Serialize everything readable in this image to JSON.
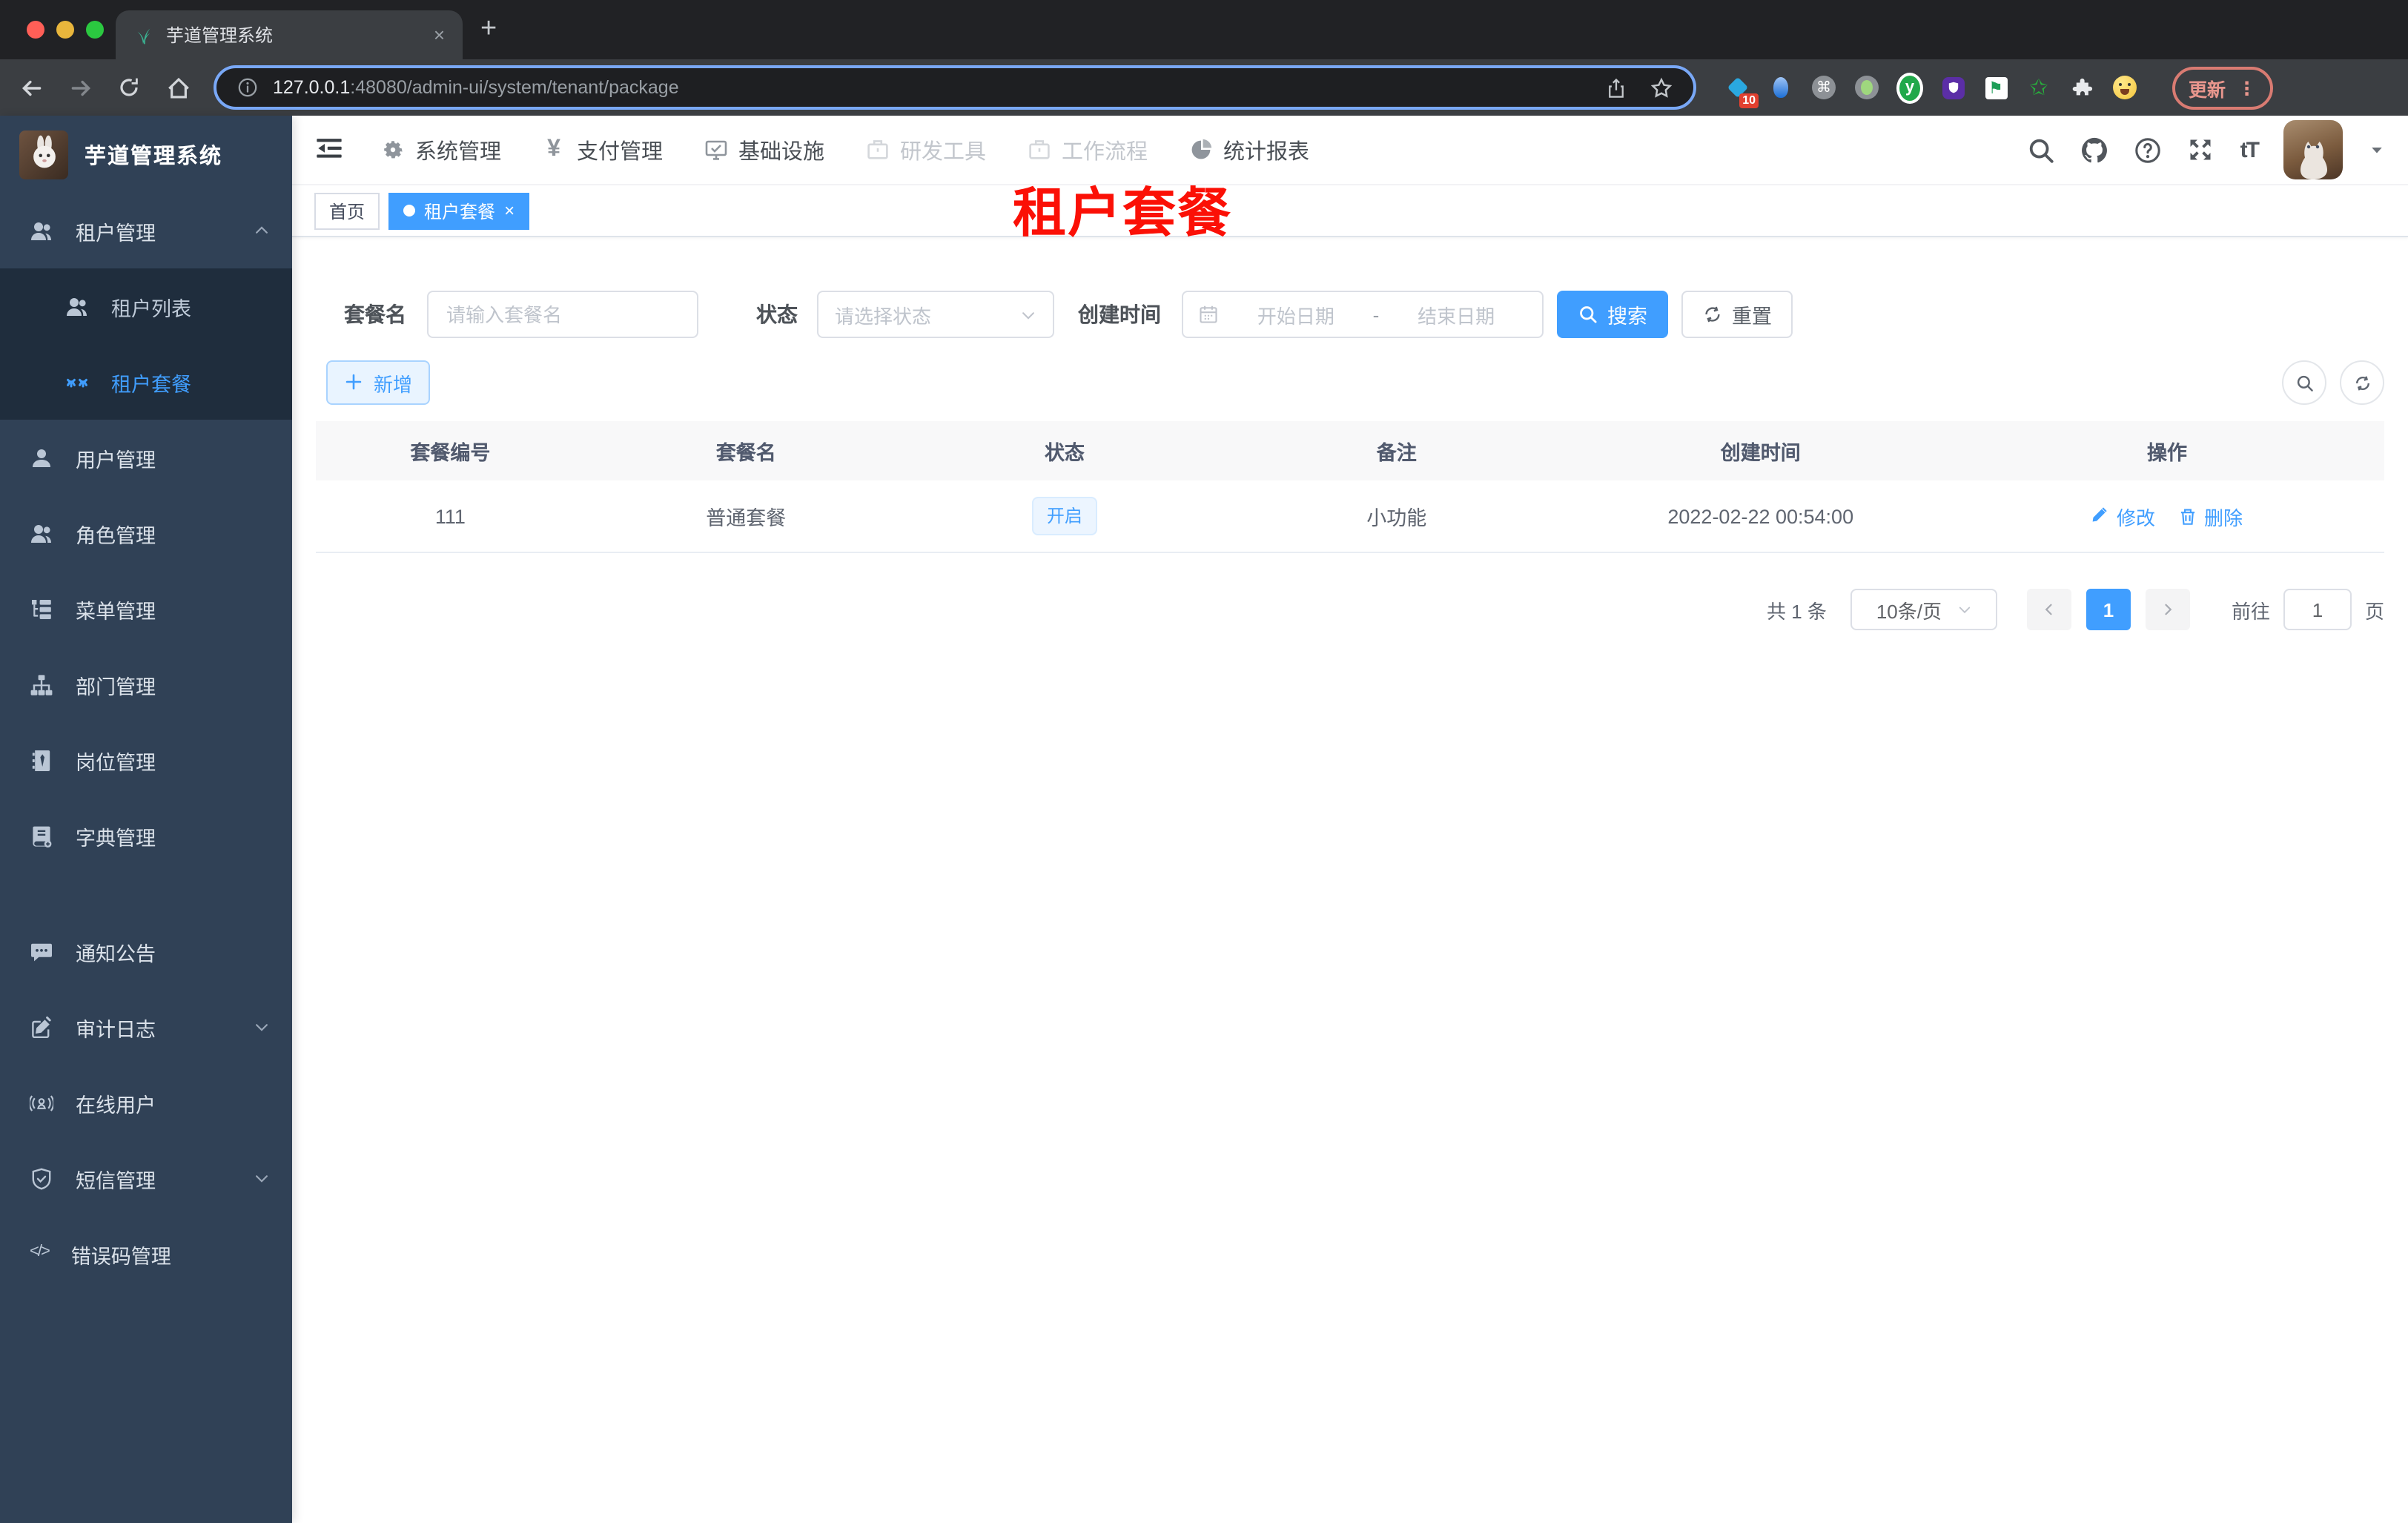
{
  "browser": {
    "tab_title": "芋道管理系统",
    "url_host": "127.0.0.1",
    "url_rest": ":48080/admin-ui/system/tenant/package",
    "update_label": "更新",
    "ext_badge": "10"
  },
  "glyphs": {
    "close": "×",
    "newtab": "+",
    "dots": "⋮",
    "yen": "¥",
    "code": "</>",
    "cmd": "⌘",
    "font_size": "tT",
    "ext_y": "y",
    "flag": "⚑",
    "star": "✩"
  },
  "sidebar": {
    "title": "芋道管理系统",
    "items": [
      {
        "label": "租户管理"
      },
      {
        "label": "租户列表"
      },
      {
        "label": "租户套餐"
      },
      {
        "label": "用户管理"
      },
      {
        "label": "角色管理"
      },
      {
        "label": "菜单管理"
      },
      {
        "label": "部门管理"
      },
      {
        "label": "岗位管理"
      },
      {
        "label": "字典管理"
      },
      {
        "label": "通知公告"
      },
      {
        "label": "审计日志"
      },
      {
        "label": "在线用户"
      },
      {
        "label": "短信管理"
      },
      {
        "label": "错误码管理"
      }
    ]
  },
  "topnav": {
    "items": [
      {
        "label": "系统管理"
      },
      {
        "label": "支付管理"
      },
      {
        "label": "基础设施"
      },
      {
        "label": "研发工具"
      },
      {
        "label": "工作流程"
      },
      {
        "label": "统计报表"
      }
    ]
  },
  "tags": {
    "home": "首页",
    "active": "租户套餐"
  },
  "annotation": "租户套餐",
  "filter": {
    "name_label": "套餐名",
    "name_placeholder": "请输入套餐名",
    "status_label": "状态",
    "status_placeholder": "请选择状态",
    "date_label": "创建时间",
    "date_start": "开始日期",
    "date_sep": "-",
    "date_end": "结束日期",
    "search": "搜索",
    "reset": "重置"
  },
  "toolbar": {
    "add": "新增"
  },
  "table": {
    "columns": [
      "套餐编号",
      "套餐名",
      "状态",
      "备注",
      "创建时间",
      "操作"
    ],
    "rows": [
      {
        "id": "111",
        "name": "普通套餐",
        "status": "开启",
        "remark": "小功能",
        "created": "2022-02-22 00:54:00",
        "edit": "修改",
        "delete": "删除"
      }
    ]
  },
  "pagination": {
    "total": "共 1 条",
    "page_size": "10条/页",
    "page": "1",
    "goto": "前往",
    "goto_value": "1",
    "page_unit": "页"
  },
  "colors": {
    "accent": "#409eff",
    "sidebar_bg": "#304156",
    "submenu_bg": "#1f2d3d",
    "annotation_red": "#fb1006"
  }
}
